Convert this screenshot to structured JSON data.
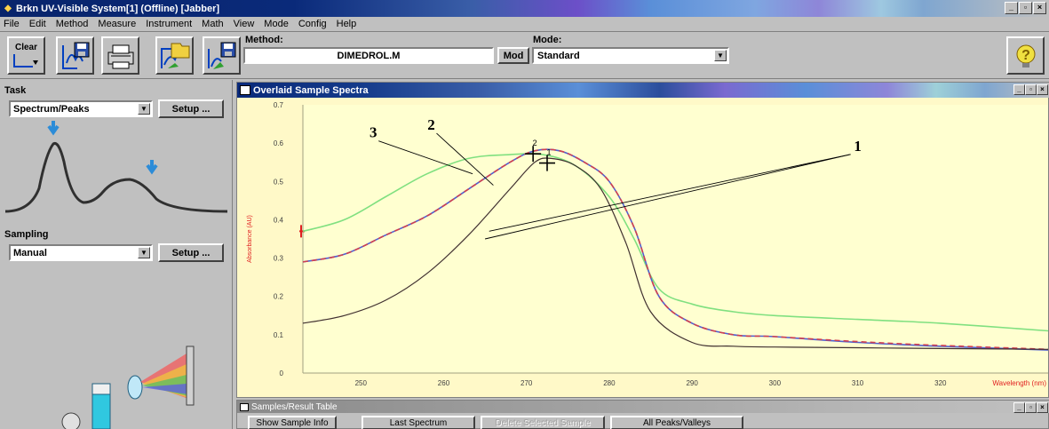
{
  "window": {
    "title": "Brkn UV-Visible System[1] (Offline) [Jabber]"
  },
  "menu": [
    "File",
    "Edit",
    "Method",
    "Measure",
    "Instrument",
    "Math",
    "View",
    "Mode",
    "Config",
    "Help"
  ],
  "toolbar": {
    "clear_label": "Clear",
    "method_label": "Method:",
    "method_value": "DIMEDROL.M",
    "mod_label": "Mod",
    "mode_label": "Mode:",
    "mode_value": "Standard"
  },
  "task": {
    "label": "Task",
    "value": "Spectrum/Peaks",
    "setup_label": "Setup ..."
  },
  "sampling": {
    "label": "Sampling",
    "value": "Manual",
    "setup_label": "Setup ..."
  },
  "spectra_window": {
    "title": "Overlaid Sample Spectra"
  },
  "table_window": {
    "title": "Samples/Result Table",
    "buttons": [
      "Show Sample Info",
      "Last Spectrum",
      "Delete Selected Sample",
      "All Peaks/Valleys"
    ]
  },
  "chart_data": {
    "type": "line",
    "xlabel": "Wavelength (nm)",
    "ylabel": "Absorbance (AU)",
    "xlim": [
      243,
      333
    ],
    "ylim": [
      0,
      0.7
    ],
    "xticks": [
      "250",
      "260",
      "270",
      "280",
      "290",
      "300",
      "310",
      "320"
    ],
    "xtick_values": [
      250,
      260,
      270,
      280,
      290,
      300,
      310,
      320
    ],
    "yticks": [
      "0",
      "0.1",
      "0.2",
      "0.3",
      "0.4",
      "0.5",
      "0.6",
      "0.7"
    ],
    "ytick_values": [
      0,
      0.1,
      0.2,
      0.3,
      0.4,
      0.5,
      0.6,
      0.7
    ],
    "grid": false,
    "series": [
      {
        "color": "#80e080",
        "x": [
          243,
          248,
          253,
          258,
          263,
          268,
          272,
          276,
          280,
          283,
          286,
          290,
          295,
          300,
          310,
          320,
          333
        ],
        "y": [
          0.37,
          0.4,
          0.46,
          0.52,
          0.56,
          0.57,
          0.57,
          0.54,
          0.46,
          0.35,
          0.22,
          0.18,
          0.16,
          0.15,
          0.14,
          0.13,
          0.11
        ]
      },
      {
        "color": "#5060d0",
        "x": [
          243,
          248,
          253,
          258,
          263,
          268,
          271,
          274,
          277,
          280,
          283,
          286,
          290,
          295,
          300,
          310,
          320,
          333
        ],
        "y": [
          0.29,
          0.31,
          0.36,
          0.41,
          0.48,
          0.55,
          0.58,
          0.58,
          0.55,
          0.5,
          0.38,
          0.2,
          0.13,
          0.1,
          0.095,
          0.08,
          0.07,
          0.06
        ]
      },
      {
        "color": "#d04050",
        "x": [
          243,
          248,
          253,
          258,
          263,
          268,
          271,
          274,
          277,
          280,
          283,
          286,
          290,
          295,
          300,
          310,
          320,
          333
        ],
        "y": [
          0.29,
          0.31,
          0.36,
          0.41,
          0.48,
          0.55,
          0.58,
          0.58,
          0.55,
          0.5,
          0.38,
          0.2,
          0.13,
          0.1,
          0.095,
          0.082,
          0.072,
          0.062
        ]
      },
      {
        "color": "#403030",
        "x": [
          243,
          248,
          253,
          258,
          263,
          268,
          271,
          273,
          276,
          279,
          282,
          285,
          290,
          295,
          300,
          310,
          320,
          333
        ],
        "y": [
          0.13,
          0.15,
          0.19,
          0.26,
          0.36,
          0.48,
          0.55,
          0.56,
          0.54,
          0.48,
          0.34,
          0.16,
          0.08,
          0.07,
          0.068,
          0.066,
          0.064,
          0.062
        ]
      }
    ],
    "annotations": [
      {
        "text": "3",
        "tx": 251.5,
        "ty": 0.615,
        "line_to": [
          [
            263.5,
            0.52
          ]
        ]
      },
      {
        "text": "2",
        "tx": 258.5,
        "ty": 0.635,
        "line_to": [
          [
            266,
            0.49
          ]
        ]
      },
      {
        "text": "1",
        "tx": 310,
        "ty": 0.58,
        "line_to": [
          [
            265.5,
            0.37
          ],
          [
            265,
            0.35
          ]
        ]
      }
    ],
    "peak_markers": [
      {
        "x": 270.8,
        "y": 0.572,
        "label": "2"
      },
      {
        "x": 272.5,
        "y": 0.548,
        "label": "1"
      }
    ]
  }
}
